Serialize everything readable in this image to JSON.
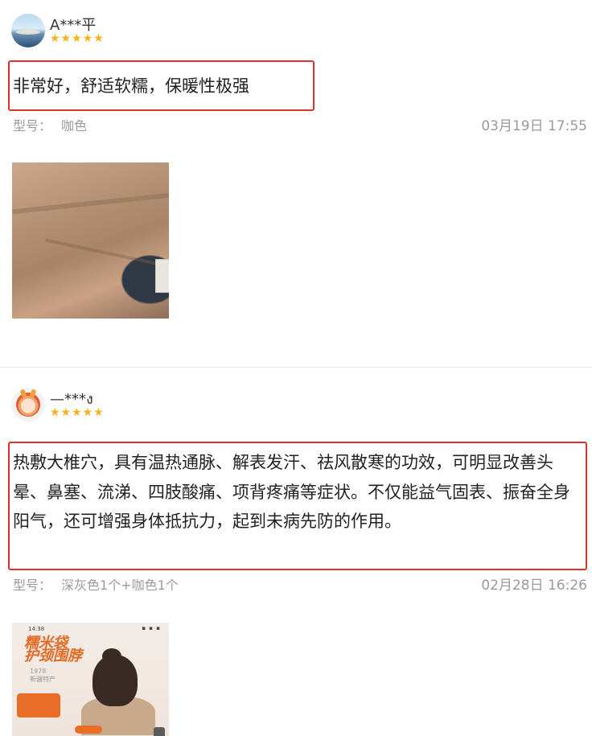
{
  "reviews": [
    {
      "username": "A***平",
      "stars": "★★★★★",
      "content": "非常好，舒适软糯，保暖性极强",
      "model_label": "型号：",
      "model_value": "咖色",
      "time": "03月19日 17:55"
    },
    {
      "username": "—***ง",
      "stars": "★★★★★",
      "content": "热敷大椎穴，具有温热通脉、解表发汗、祛风散寒的功效，可明显改善头晕、鼻塞、流涕、四肢酸痛、项背疼痛等症状。不仅能益气固表、振奋全身阳气，还可增强身体抵抗力，起到未病先防的作用。",
      "model_label": "型号：",
      "model_value": "深灰色1个+咖色1个",
      "time": "02月28日 16:26",
      "photo": {
        "status_time": "14:38",
        "status_icons": "▪ ▪ ▪",
        "banner_title_line1": "糯米袋",
        "banner_title_line2": "护颈围脖",
        "banner_sub_line1": "1978",
        "banner_sub_line2": "新疆特产"
      }
    }
  ],
  "colors": {
    "highlight_border": "#e0302a",
    "star": "#f7b11c",
    "meta_text": "#9a9a9a"
  },
  "icons": [
    "avatar-landscape",
    "avatar-dragon-cartoon",
    "star-icon"
  ]
}
